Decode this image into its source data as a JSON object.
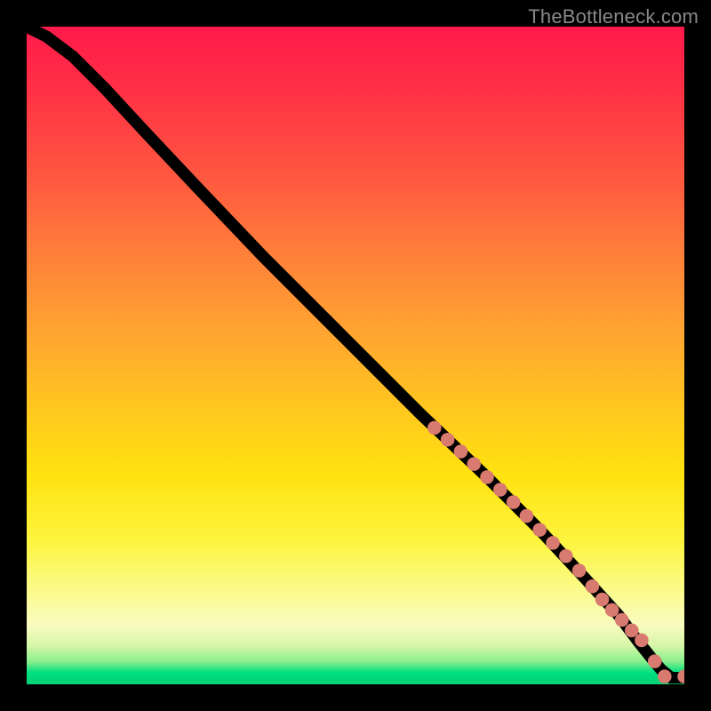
{
  "watermark": "TheBottleneck.com",
  "chart_data": {
    "type": "line",
    "title": "",
    "xlabel": "",
    "ylabel": "",
    "xlim": [
      0,
      100
    ],
    "ylim": [
      0,
      100
    ],
    "grid": false,
    "legend": false,
    "series": [
      {
        "name": "curve",
        "x": [
          0,
          3,
          7,
          12,
          18,
          26,
          36,
          48,
          60,
          70,
          78,
          85,
          90,
          93,
          95,
          96.5,
          98,
          100
        ],
        "y": [
          100,
          98.5,
          95.5,
          90.5,
          84,
          75.5,
          65,
          53,
          41,
          31.5,
          23.5,
          16,
          10.5,
          6.5,
          4,
          2.2,
          1.0,
          1.0
        ]
      }
    ],
    "markers": {
      "name": "highlighted-points",
      "color": "#d87a6f",
      "x": [
        62,
        64,
        66,
        68,
        70,
        72,
        74,
        76,
        78,
        80,
        82,
        84,
        86,
        87.5,
        89,
        90.5,
        92,
        93.5,
        95.5,
        97,
        100
      ],
      "y": [
        39.0,
        37.2,
        35.4,
        33.5,
        31.5,
        29.6,
        27.7,
        25.6,
        23.5,
        21.5,
        19.5,
        17.3,
        14.9,
        12.9,
        11.3,
        9.8,
        8.2,
        6.7,
        3.5,
        1.2,
        1.2
      ]
    }
  }
}
